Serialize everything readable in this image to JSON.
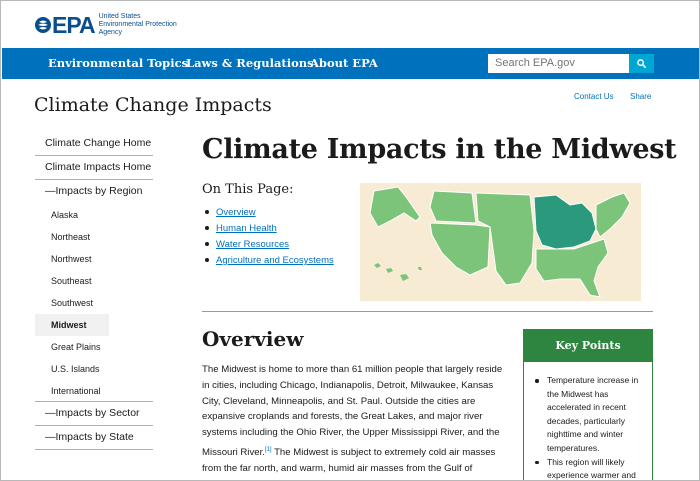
{
  "header": {
    "logo_text": "EPA",
    "logo_sub": [
      "United States",
      "Environmental Protection",
      "Agency"
    ]
  },
  "nav": {
    "items": [
      "Environmental Topics",
      "Laws & Regulations",
      "About EPA"
    ],
    "search_placeholder": "Search EPA.gov"
  },
  "page": {
    "site_title": "Climate Change Impacts",
    "contact_us": "Contact Us",
    "share": "Share"
  },
  "sidebar": {
    "items": [
      {
        "label": "Climate Change Home",
        "level": 1
      },
      {
        "label": "Climate Impacts Home",
        "level": 1
      },
      {
        "label": "—Impacts by Region",
        "level": 1
      },
      {
        "label": "Alaska",
        "level": 2
      },
      {
        "label": "Northeast",
        "level": 2
      },
      {
        "label": "Northwest",
        "level": 2
      },
      {
        "label": "Southeast",
        "level": 2
      },
      {
        "label": "Southwest",
        "level": 2
      },
      {
        "label": "Midwest",
        "level": 2,
        "active": true
      },
      {
        "label": "Great Plains",
        "level": 2
      },
      {
        "label": "U.S. Islands",
        "level": 2
      },
      {
        "label": "International",
        "level": 2
      },
      {
        "label": "—Impacts by Sector",
        "level": 1
      },
      {
        "label": "—Impacts by State",
        "level": 1
      }
    ]
  },
  "main": {
    "heading": "Climate Impacts in the Midwest",
    "on_this_page": "On This Page:",
    "toc": [
      "Overview",
      "Human Health",
      "Water Resources",
      "Agriculture and Ecosystems"
    ],
    "overview_heading": "Overview",
    "overview_text_a": "The Midwest is home to more than 61 million people that largely reside in cities, including Chicago, Indianapolis, Detroit, Milwaukee, Kansas City, Cleveland, Minneapolis, and St. Paul. Outside the cities are expansive croplands and forests, the Great Lakes, and major river systems including the Ohio River, the Upper Mississippi River, and the Missouri River.",
    "overview_ref": "[1]",
    "overview_text_b": " The Midwest is subject to extremely cold air masses from the far north, and warm, humid air masses from the Gulf of Mexico, resulting in a wide range of both temperature"
  },
  "key_points": {
    "title": "Key Points",
    "items": [
      "Temperature increase in the Midwest has accelerated in recent decades, particularly nighttime and winter temperatures.",
      "This region will likely experience warmer and"
    ]
  },
  "colors": {
    "nav_blue": "#0071bc",
    "search_button": "#00a6d2",
    "key_points_green": "#2e8540",
    "map_background": "#f7ecd3",
    "map_region": "#7cc47a",
    "map_highlight": "#2b9a7c"
  },
  "icons": {
    "search": "search-icon",
    "logo": "epa-logo-icon"
  }
}
